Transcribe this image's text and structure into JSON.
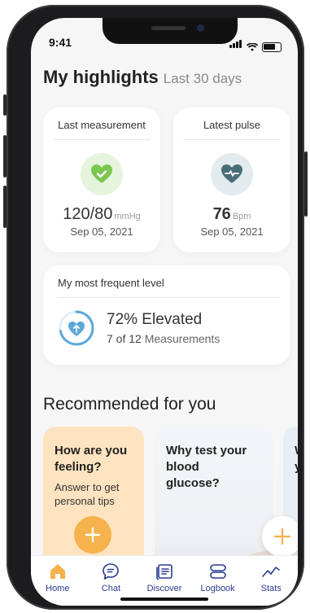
{
  "status": {
    "time": "9:41"
  },
  "highlights": {
    "title": "My highlights",
    "period": "Last 30 days"
  },
  "last_measurement": {
    "label": "Last measurement",
    "value": "120/80",
    "unit": "mmHg",
    "date": "Sep 05, 2021"
  },
  "latest_pulse": {
    "label": "Latest pulse",
    "value": "76",
    "unit": "Bpm",
    "date": "Sep 05, 2021"
  },
  "frequent_level": {
    "label": "My most frequent level",
    "percent_label": "72% Elevated",
    "count": "7 of 12",
    "count_suffix": "Measurements",
    "fraction": 0.72
  },
  "recommended": {
    "title": "Recommended for you",
    "cards": [
      {
        "title": "How are you feeling?",
        "desc": "Answer to get personal tips"
      },
      {
        "title": "Why test your blood glucose?"
      },
      {
        "title": "W y"
      }
    ]
  },
  "nav": [
    {
      "label": "Home",
      "icon": "home-icon"
    },
    {
      "label": "Chat",
      "icon": "chat-icon"
    },
    {
      "label": "Discover",
      "icon": "discover-icon"
    },
    {
      "label": "Logbook",
      "icon": "logbook-icon"
    },
    {
      "label": "Stats",
      "icon": "stats-icon"
    }
  ],
  "colors": {
    "accent": "#f6b24d",
    "nav_text": "#2a3b8f",
    "heart_green": "#7ac74f",
    "heart_slate": "#4b6d78",
    "ring_blue": "#5ba8d8"
  }
}
